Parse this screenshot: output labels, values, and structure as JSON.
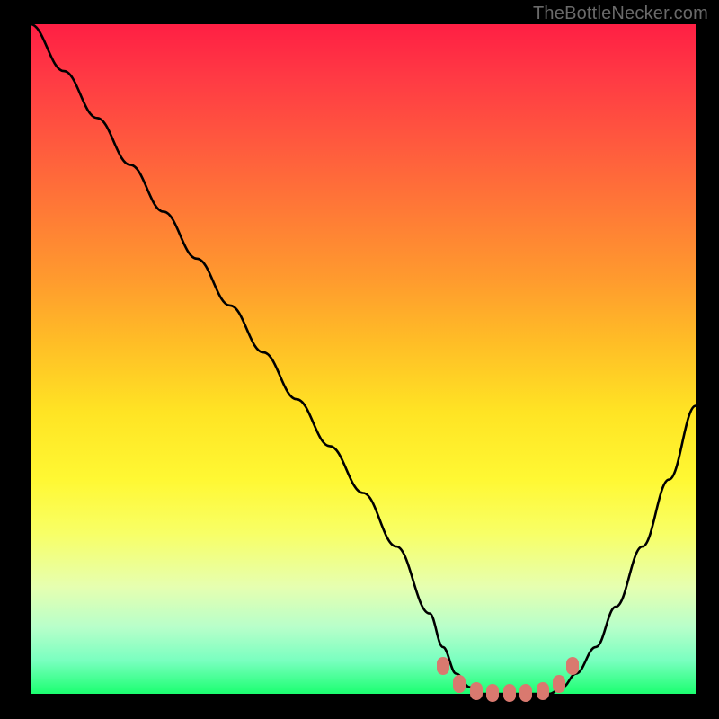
{
  "watermark": "TheBottleNecker.com",
  "chart_data": {
    "type": "line",
    "title": "",
    "xlabel": "",
    "ylabel": "",
    "xlim": [
      0,
      100
    ],
    "ylim": [
      0,
      100
    ],
    "series": [
      {
        "name": "bottleneck-curve",
        "x": [
          0,
          5,
          10,
          15,
          20,
          25,
          30,
          35,
          40,
          45,
          50,
          55,
          60,
          62,
          64,
          66,
          68,
          70,
          72,
          74,
          76,
          78,
          80,
          82,
          85,
          88,
          92,
          96,
          100
        ],
        "y": [
          100,
          93,
          86,
          79,
          72,
          65,
          58,
          51,
          44,
          37,
          30,
          22,
          12,
          7,
          3,
          1,
          0,
          0,
          0,
          0,
          0,
          0,
          1,
          3,
          7,
          13,
          22,
          32,
          43
        ]
      }
    ],
    "markers": {
      "name": "optimal-range-dots",
      "color": "#d9796f",
      "points_x": [
        62,
        64.5,
        67,
        69.5,
        72,
        74.5,
        77,
        79.5,
        81.5
      ],
      "points_y": [
        4.2,
        1.5,
        0.4,
        0.1,
        0.1,
        0.1,
        0.4,
        1.5,
        4.2
      ]
    },
    "background_gradient": {
      "top": "#ff1f44",
      "mid": "#ffe424",
      "bottom": "#1bff70"
    }
  }
}
